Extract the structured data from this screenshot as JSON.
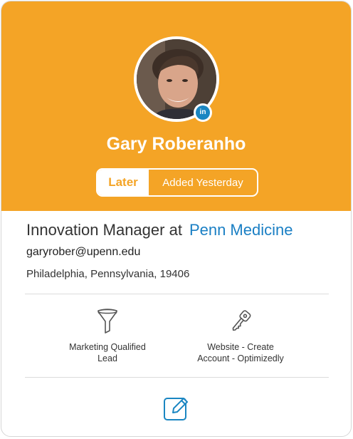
{
  "profile": {
    "name": "Gary Roberanho",
    "status_label": "Later",
    "added_label": "Added Yesterday",
    "linkedin_badge": "in",
    "job_title": "Innovation Manager at",
    "company": "Penn Medicine",
    "email": "garyrober@upenn.edu",
    "location": "Philadelphia, Pennsylvania, 19406"
  },
  "features": [
    {
      "icon": "funnel-icon",
      "label_line1": "Marketing Qualified",
      "label_line2": "Lead"
    },
    {
      "icon": "key-icon",
      "label_line1": "Website - Create",
      "label_line2": "Account - Optimizedly"
    }
  ],
  "actions": {
    "edit_icon": "edit-icon"
  },
  "colors": {
    "header": "#f4a426",
    "link": "#1a7fc4",
    "icon": "#1a86c2",
    "linkedin": "#1a86c2"
  }
}
